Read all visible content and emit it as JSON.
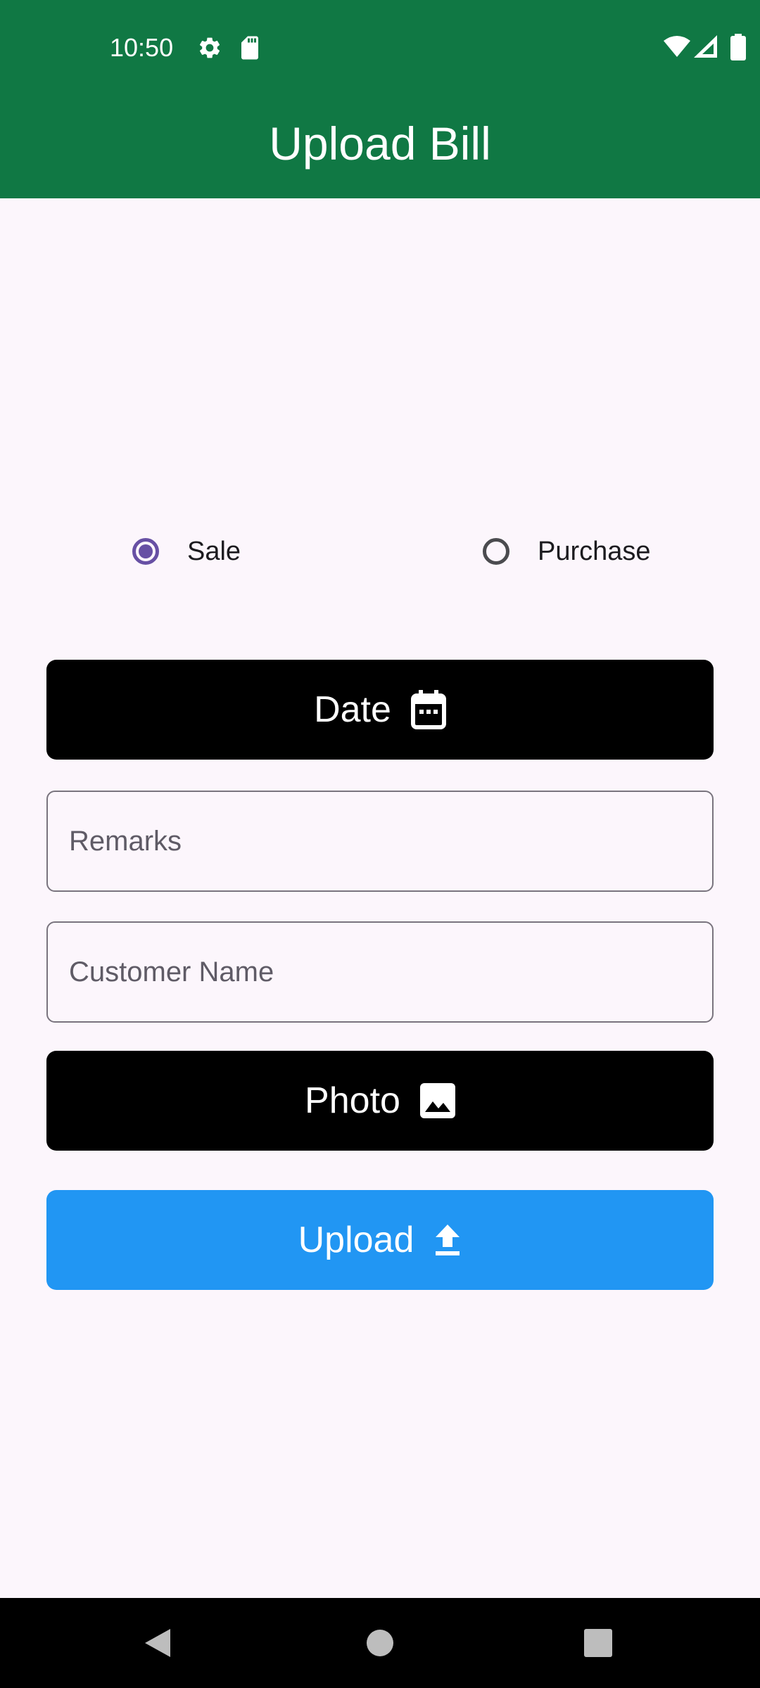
{
  "status_bar": {
    "time": "10:50",
    "icons": [
      "settings-icon",
      "sd-card-icon",
      "wifi-icon",
      "signal-icon",
      "battery-icon"
    ]
  },
  "app_bar": {
    "title": "Upload Bill",
    "color": "#107844"
  },
  "bill_type": {
    "options": [
      {
        "label": "Sale",
        "selected": true
      },
      {
        "label": "Purchase",
        "selected": false
      }
    ],
    "accent": "#6750A4"
  },
  "form": {
    "date_button": {
      "label": "Date",
      "icon": "calendar-icon"
    },
    "remarks": {
      "value": "",
      "placeholder": "Remarks"
    },
    "customer_name": {
      "value": "",
      "placeholder": "Customer Name"
    },
    "photo_button": {
      "label": "Photo",
      "icon": "image-icon"
    },
    "upload_button": {
      "label": "Upload",
      "icon": "upload-icon",
      "color": "#2196F3"
    }
  },
  "nav_bar": {
    "buttons": [
      "back-icon",
      "home-icon",
      "recents-icon"
    ]
  }
}
